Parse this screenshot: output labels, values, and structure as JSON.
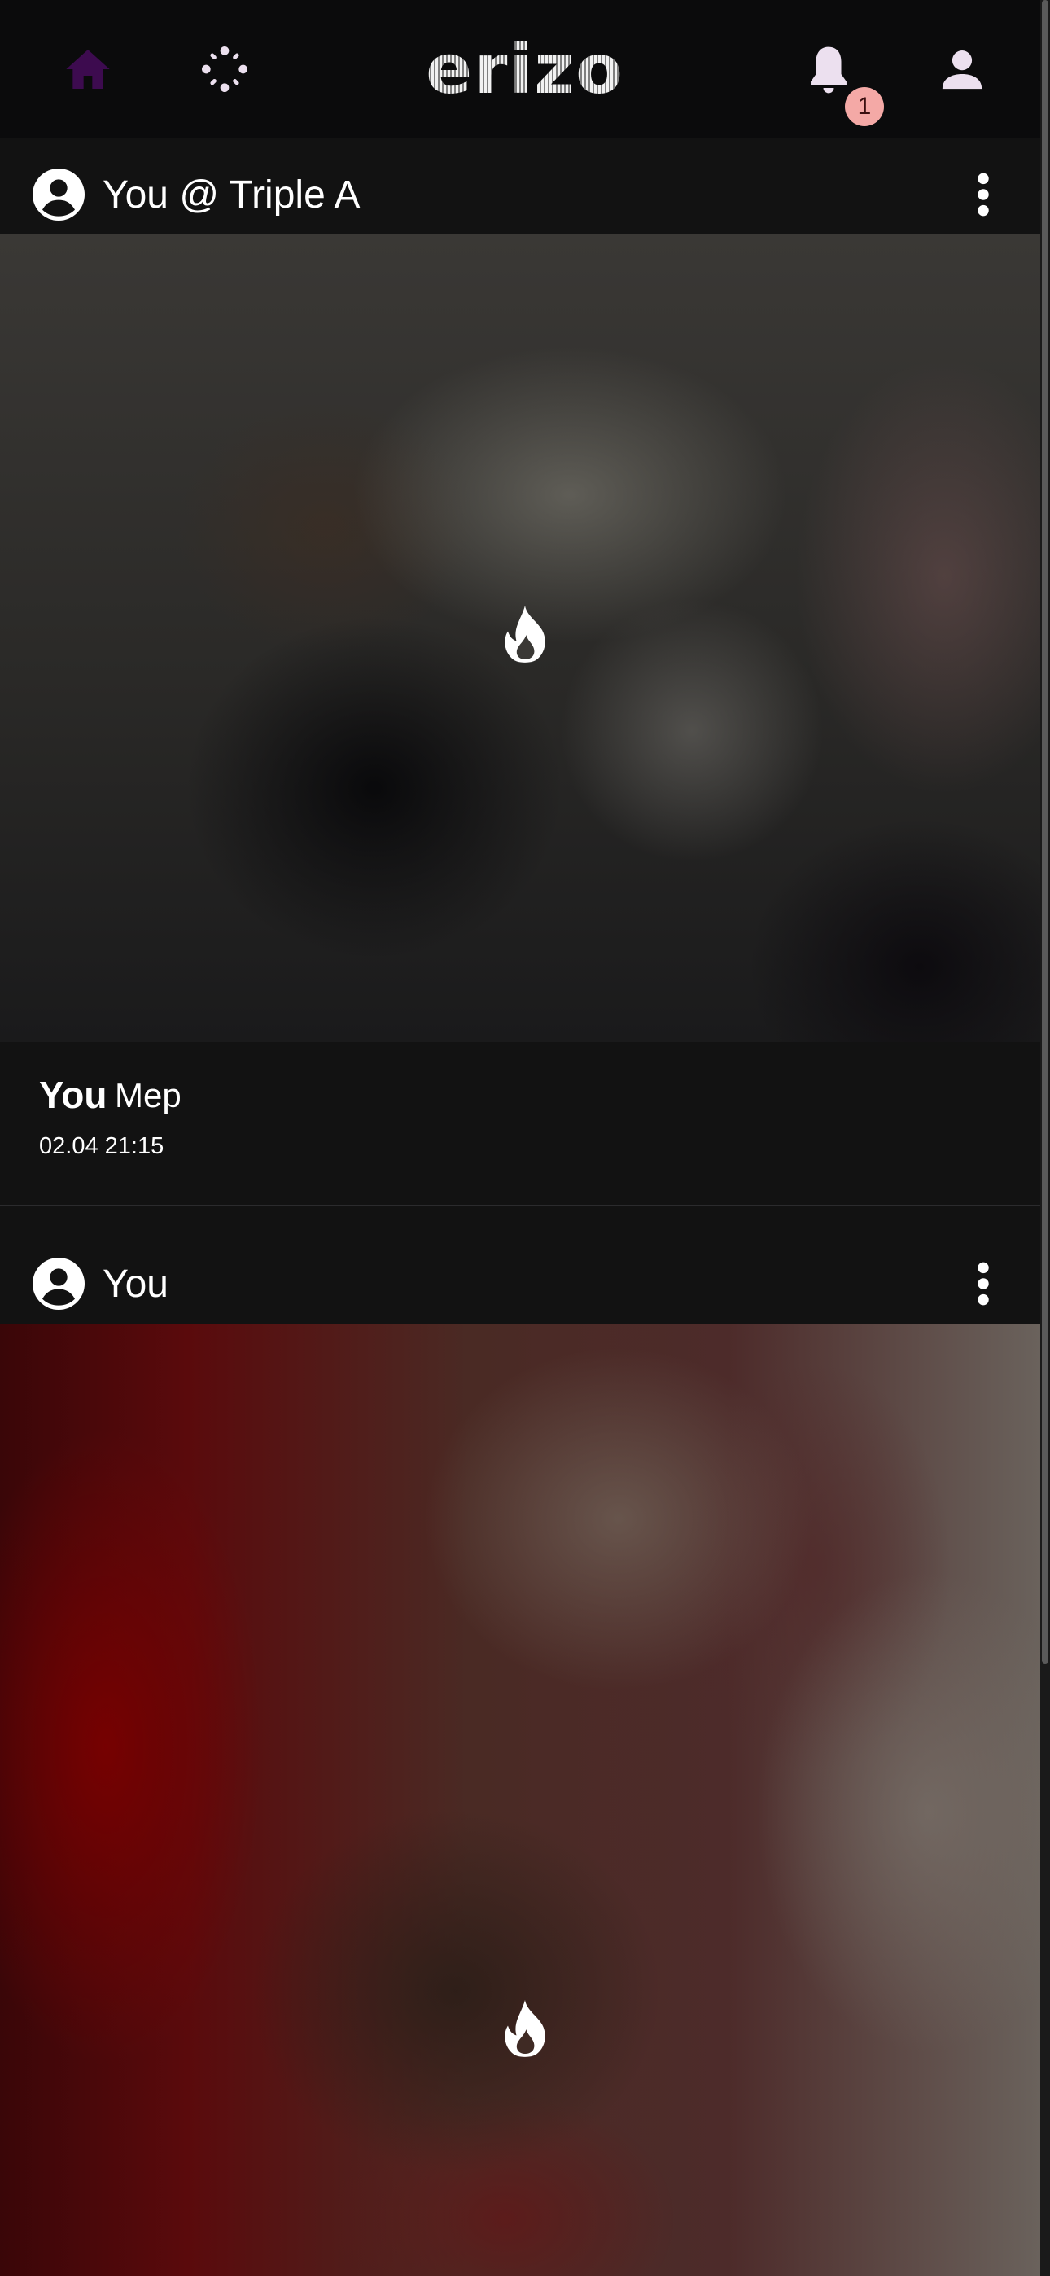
{
  "app": {
    "logo_text": "erizo",
    "notification_count": "1",
    "colors": {
      "home_active": "#3d0b4f",
      "icon_light": "#ece0ef",
      "badge": "#f4a9a6",
      "background": "#121212"
    }
  },
  "nav": {
    "icons": [
      "home-icon",
      "sparkle-icon",
      "bell-icon",
      "account-icon"
    ]
  },
  "posts": [
    {
      "header_title": "You @ Triple A",
      "author": "You",
      "caption": "Mep",
      "timestamp": "02.04 21:15",
      "media_icon": "fire-icon"
    },
    {
      "header_title": "You",
      "media_icon": "fire-icon"
    }
  ]
}
